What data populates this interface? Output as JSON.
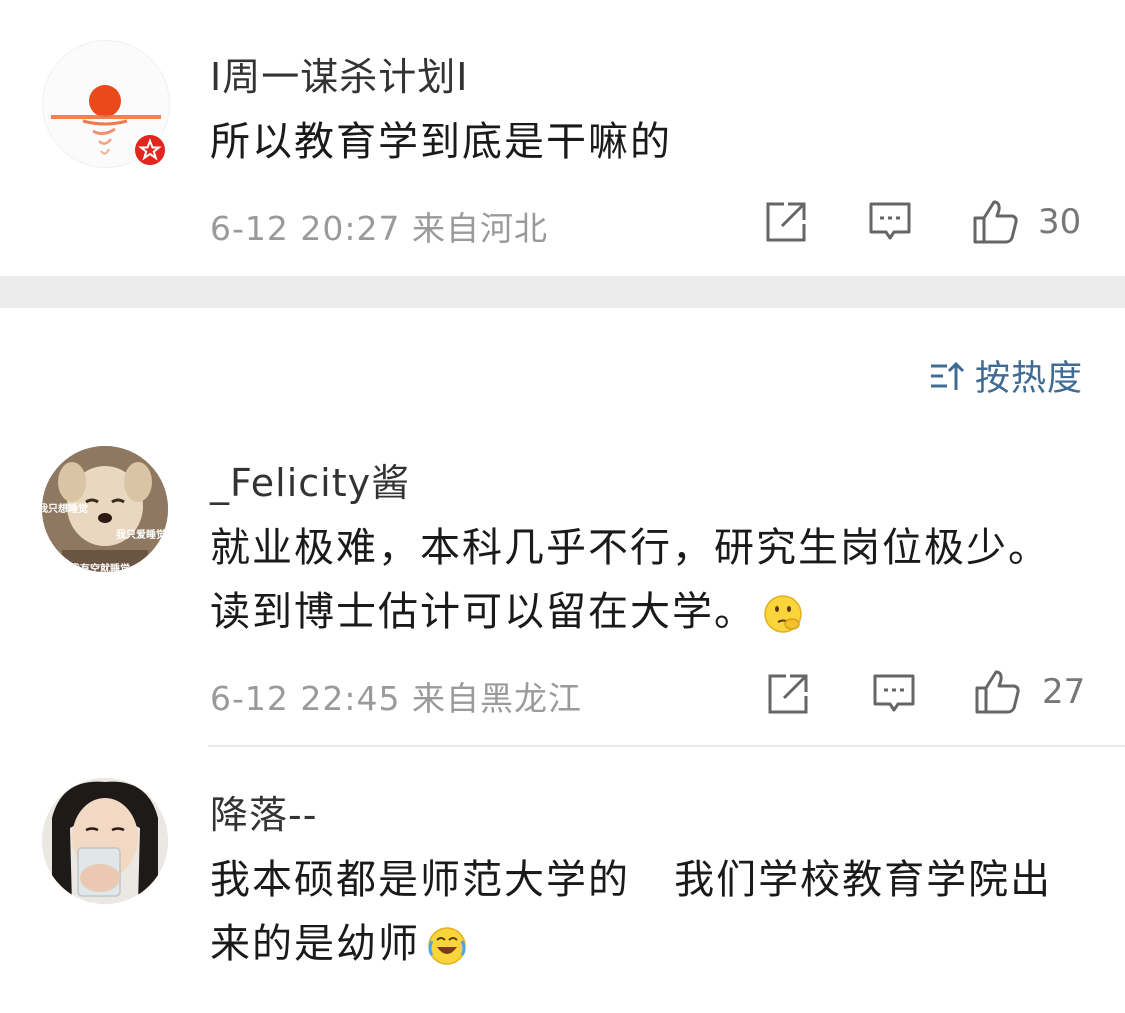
{
  "comments": [
    {
      "username": "I周一谋杀计划I",
      "lines": [
        "所以教育学到底是干嘛的"
      ],
      "time": "6-12 20:27",
      "location": "来自河北",
      "likes": "30"
    },
    {
      "username": "_Felicity酱",
      "lines": [
        "就业极难，本科几乎不行，研究生岗位极少。",
        "读到博士估计可以留在大学。"
      ],
      "time": "6-12 22:45",
      "location": "来自黑龙江",
      "likes": "27",
      "avatar_texts": [
        "我只想睡觉",
        "我只爱睡觉",
        "我有空就睡觉"
      ]
    },
    {
      "username": "降落--",
      "lines": [
        "我本硕都是师范大学的   我们学校教育学院出",
        "来的是幼师"
      ]
    }
  ],
  "sort": {
    "label": "按热度"
  },
  "colors": {
    "link_blue": "#3f6b95",
    "meta_gray": "#9a9a9a",
    "badge_red": "#e2261f",
    "separator": "#ececec"
  }
}
